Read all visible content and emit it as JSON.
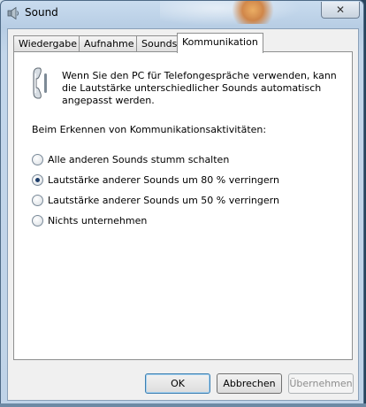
{
  "window": {
    "title": "Sound",
    "close_glyph": "✕"
  },
  "tabs": [
    {
      "label": "Wiedergabe",
      "active": false
    },
    {
      "label": "Aufnahme",
      "active": false
    },
    {
      "label": "Sounds",
      "active": false
    },
    {
      "label": "Kommunikation",
      "active": true
    }
  ],
  "panel": {
    "icon": "phone-icon",
    "intro": "Wenn Sie den PC für Telefongespräche verwenden, kann die Lautstärke unterschiedlicher Sounds automatisch angepasst werden.",
    "question": "Beim Erkennen von Kommunikationsaktivitäten:",
    "options": [
      {
        "label": "Alle anderen Sounds stumm schalten",
        "checked": false
      },
      {
        "label": "Lautstärke anderer Sounds um 80 % verringern",
        "checked": true
      },
      {
        "label": "Lautstärke anderer Sounds um 50 % verringern",
        "checked": false
      },
      {
        "label": "Nichts unternehmen",
        "checked": false
      }
    ]
  },
  "buttons": {
    "ok": "OK",
    "cancel": "Abbrechen",
    "apply": "Übernehmen",
    "apply_enabled": false
  }
}
